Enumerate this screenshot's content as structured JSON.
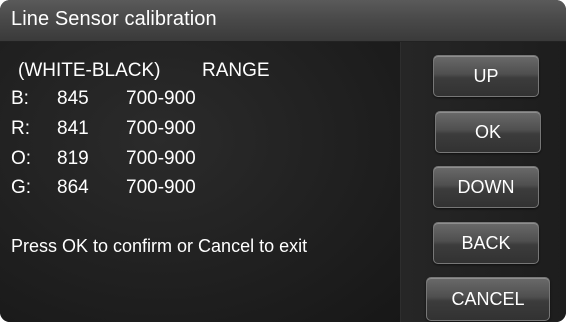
{
  "title": "Line Sensor calibration",
  "header": {
    "label": "(WHITE-BLACK)",
    "range_label": "RANGE"
  },
  "rows": [
    {
      "channel": "B:",
      "value": "845",
      "range": "700-900"
    },
    {
      "channel": "R:",
      "value": "841",
      "range": "700-900"
    },
    {
      "channel": "O:",
      "value": "819",
      "range": "700-900"
    },
    {
      "channel": "G:",
      "value": "864",
      "range": "700-900"
    }
  ],
  "message": "Press OK to confirm or Cancel to exit",
  "buttons": {
    "up": "UP",
    "ok": "OK",
    "down": "DOWN",
    "back": "BACK",
    "cancel": "CANCEL"
  }
}
